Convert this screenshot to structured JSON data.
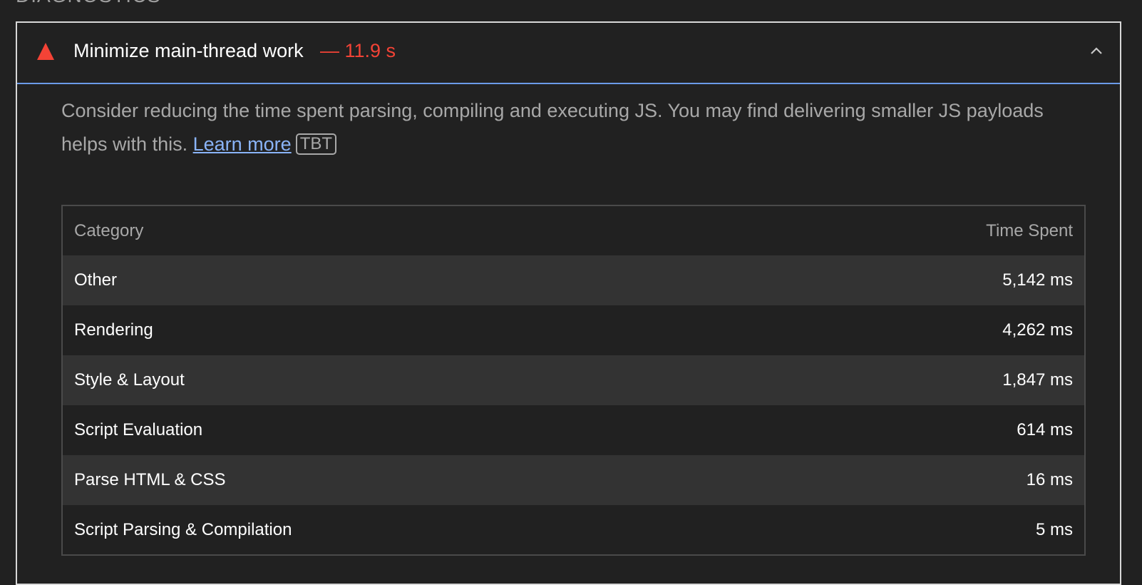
{
  "section": {
    "heading": "DIAGNOSTICS"
  },
  "audit": {
    "title": "Minimize main-thread work",
    "value": "— 11.9 s",
    "status_color": "#f44336",
    "status_icon": "fail-triangle-icon",
    "expanded": true,
    "description": "Consider reducing the time spent parsing, compiling and executing JS. You may find delivering smaller JS payloads helps with this.",
    "learn_more_label": "Learn more",
    "badge": "TBT"
  },
  "table": {
    "headers": {
      "category": "Category",
      "time_spent": "Time Spent"
    },
    "rows": [
      {
        "category": "Other",
        "time": "5,142 ms"
      },
      {
        "category": "Rendering",
        "time": "4,262 ms"
      },
      {
        "category": "Style & Layout",
        "time": "1,847 ms"
      },
      {
        "category": "Script Evaluation",
        "time": "614 ms"
      },
      {
        "category": "Parse HTML & CSS",
        "time": "16 ms"
      },
      {
        "category": "Script Parsing & Compilation",
        "time": "5 ms"
      }
    ]
  }
}
